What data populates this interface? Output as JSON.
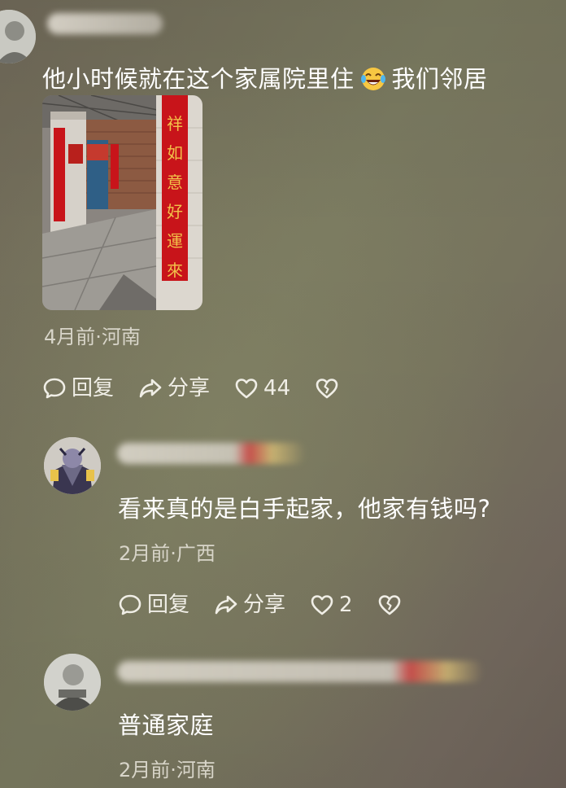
{
  "comments": [
    {
      "text_before_emoji": "他小时候就在这个家属院里住",
      "emoji": "laughing-crying-emoji",
      "text_after_emoji": "我们邻居",
      "meta": "4月前·河南",
      "reply_label": "回复",
      "share_label": "分享",
      "like_count": "44"
    },
    {
      "text": "看来真的是白手起家，他家有钱吗?",
      "meta": "2月前·广西",
      "reply_label": "回复",
      "share_label": "分享",
      "like_count": "2"
    },
    {
      "text": "普通家庭",
      "meta": "2月前·河南"
    }
  ],
  "photo": {
    "couplet_text": "祥如意好運來"
  },
  "icons": [
    "comment-bubble-icon",
    "share-arrow-icon",
    "heart-icon",
    "broken-heart-icon"
  ],
  "colors": {
    "text": "#ffffff",
    "meta": "#d8d5c9",
    "couplet_red": "#c8141a",
    "couplet_gold": "#f2c24a"
  }
}
